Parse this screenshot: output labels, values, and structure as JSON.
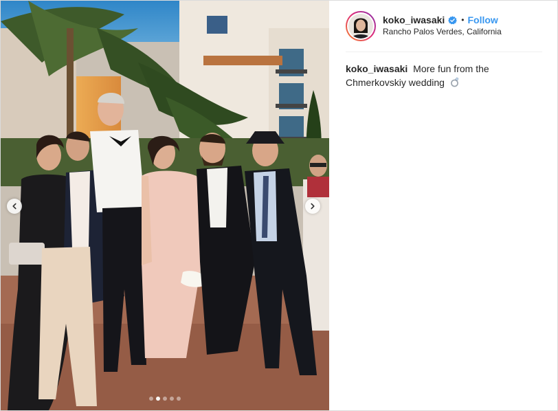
{
  "post": {
    "author": {
      "username": "koko_iwasaki",
      "verified": true,
      "follow_label": "Follow",
      "separator": "•",
      "location": "Rancho Palos Verdes, California"
    },
    "caption": {
      "username": "koko_iwasaki",
      "text": "More fun from the Chmerkovskiy wedding",
      "emoji": "ring-icon"
    },
    "carousel": {
      "slide_count": 5,
      "active_index": 1
    },
    "colors": {
      "follow_blue": "#3897f0",
      "verified_blue": "#3897f0",
      "text": "#262626",
      "border": "#dbdbdb"
    }
  }
}
